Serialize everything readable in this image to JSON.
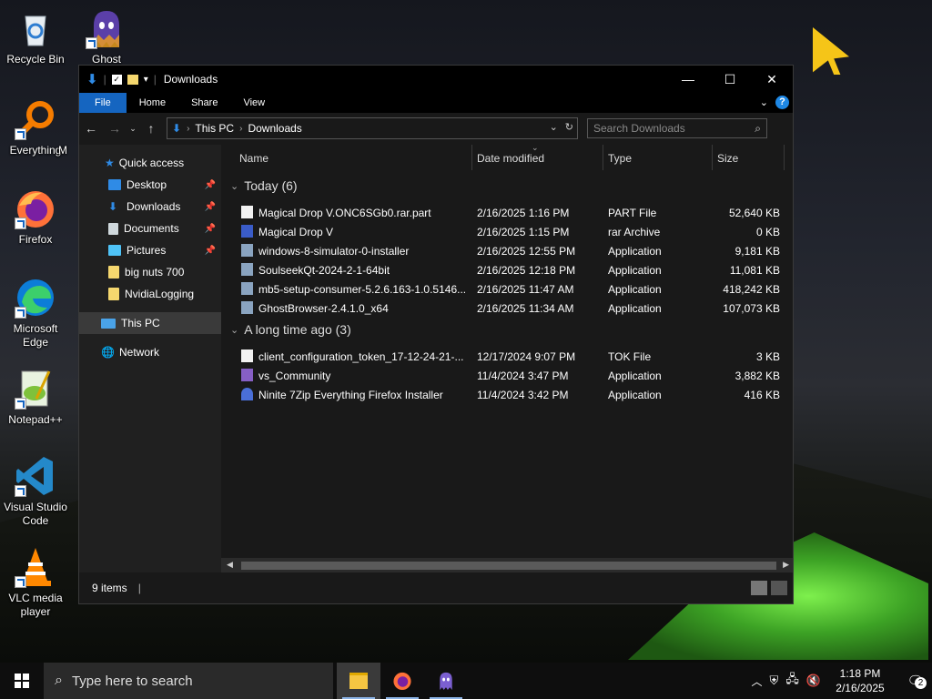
{
  "desktop": {
    "icons": [
      {
        "label": "Recycle Bin",
        "icon": "recycle-bin-icon"
      },
      {
        "label": "Ghost",
        "icon": "ghost-icon"
      },
      {
        "label": "Everything",
        "icon": "everything-search-icon"
      },
      {
        "label": "Firefox",
        "icon": "firefox-icon"
      },
      {
        "label": "Microsoft Edge",
        "icon": "edge-icon"
      },
      {
        "label": "Notepad++",
        "icon": "notepadpp-icon"
      },
      {
        "label": "Visual Studio Code",
        "icon": "vscode-icon"
      },
      {
        "label": "VLC media player",
        "icon": "vlc-icon"
      }
    ],
    "partial_label": "M"
  },
  "explorer": {
    "title": "Downloads",
    "window_controls": {
      "minimize": "—",
      "maximize": "☐",
      "close": "✕"
    },
    "ribbon_tabs": [
      "File",
      "Home",
      "Share",
      "View"
    ],
    "breadcrumb": [
      "This PC",
      "Downloads"
    ],
    "search_placeholder": "Search Downloads",
    "nav": {
      "quick_access": "Quick access",
      "pinned": [
        {
          "label": "Desktop",
          "pinned": true,
          "color": "#2f8be6"
        },
        {
          "label": "Downloads",
          "pinned": true,
          "color": "#2f8be6"
        },
        {
          "label": "Documents",
          "pinned": true,
          "color": "#cfd8dc"
        },
        {
          "label": "Pictures",
          "pinned": true,
          "color": "#4fc3f7"
        },
        {
          "label": "big nuts 700",
          "pinned": false,
          "color": "#f5d76e"
        },
        {
          "label": "NvidiaLogging",
          "pinned": false,
          "color": "#f5d76e"
        }
      ],
      "this_pc": "This PC",
      "network": "Network"
    },
    "columns": {
      "name": "Name",
      "date": "Date modified",
      "type": "Type",
      "size": "Size"
    },
    "groups": [
      {
        "label": "Today (6)",
        "files": [
          {
            "name": "Magical Drop V.ONC6SGb0.rar.part",
            "date": "2/16/2025 1:16 PM",
            "type": "PART File",
            "size": "52,640 KB",
            "icon": "file-icon"
          },
          {
            "name": "Magical Drop V",
            "date": "2/16/2025 1:15 PM",
            "type": "rar Archive",
            "size": "0 KB",
            "icon": "rar-icon"
          },
          {
            "name": "windows-8-simulator-0-installer",
            "date": "2/16/2025 12:55 PM",
            "type": "Application",
            "size": "9,181 KB",
            "icon": "installer-icon"
          },
          {
            "name": "SoulseekQt-2024-2-1-64bit",
            "date": "2/16/2025 12:18 PM",
            "type": "Application",
            "size": "11,081 KB",
            "icon": "installer-icon"
          },
          {
            "name": "mb5-setup-consumer-5.2.6.163-1.0.5146...",
            "date": "2/16/2025 11:47 AM",
            "type": "Application",
            "size": "418,242 KB",
            "icon": "installer-icon"
          },
          {
            "name": "GhostBrowser-2.4.1.0_x64",
            "date": "2/16/2025 11:34 AM",
            "type": "Application",
            "size": "107,073 KB",
            "icon": "installer-icon"
          }
        ]
      },
      {
        "label": "A long time ago (3)",
        "files": [
          {
            "name": "client_configuration_token_17-12-24-21-...",
            "date": "12/17/2024 9:07 PM",
            "type": "TOK File",
            "size": "3 KB",
            "icon": "file-icon"
          },
          {
            "name": "vs_Community",
            "date": "11/4/2024 3:47 PM",
            "type": "Application",
            "size": "3,882 KB",
            "icon": "visual-studio-icon"
          },
          {
            "name": "Ninite 7Zip Everything Firefox Installer",
            "date": "11/4/2024 3:42 PM",
            "type": "Application",
            "size": "416 KB",
            "icon": "ninite-icon"
          }
        ]
      }
    ],
    "status": "9 items"
  },
  "taskbar": {
    "search_placeholder": "Type here to search",
    "time": "1:18 PM",
    "date": "2/16/2025",
    "notification_count": "2"
  }
}
